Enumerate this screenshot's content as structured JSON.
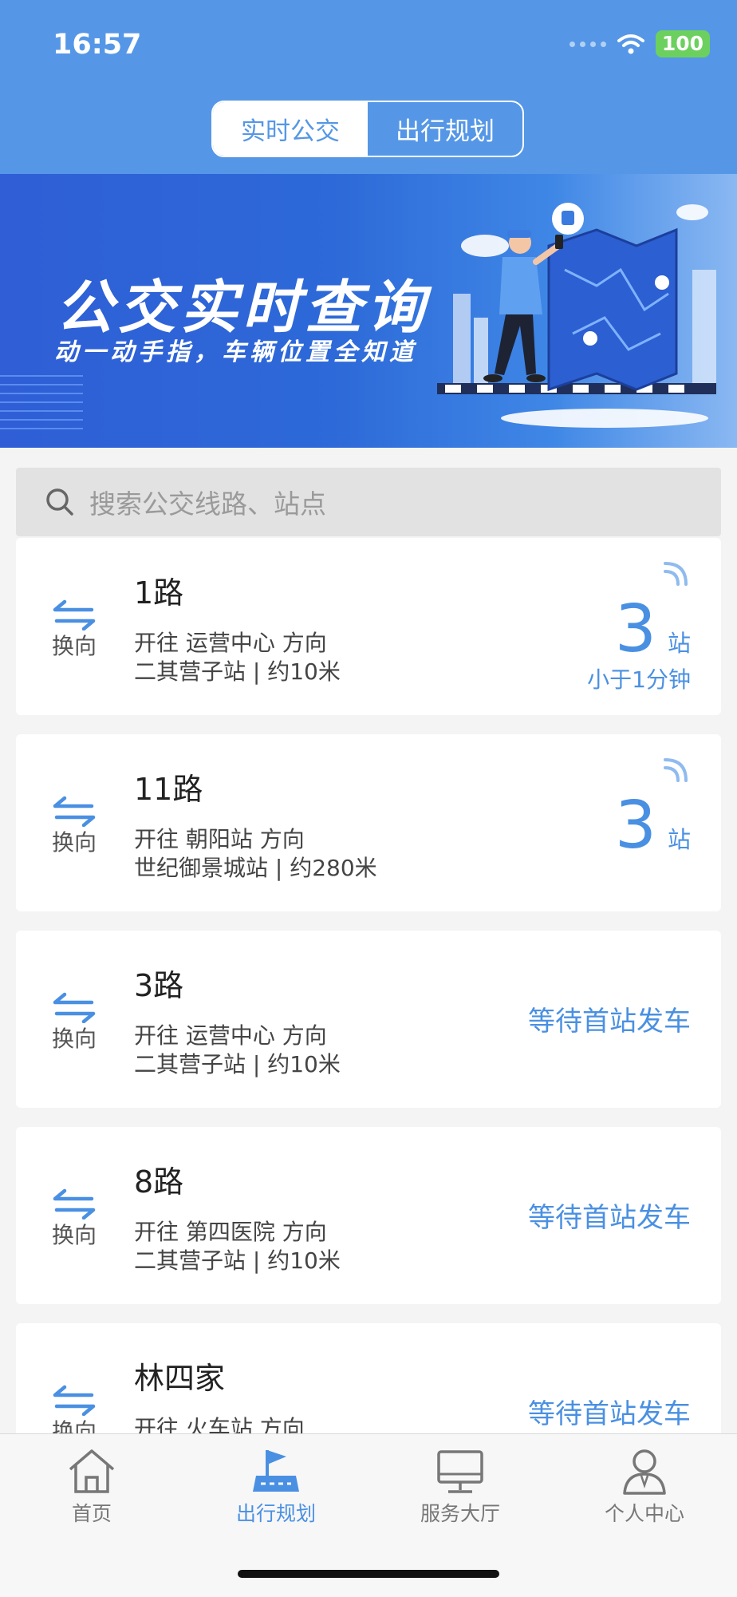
{
  "status_bar": {
    "time": "16:57",
    "battery": "100"
  },
  "segment": {
    "tabs": [
      "实时公交",
      "出行规划"
    ],
    "active_index": 0
  },
  "banner": {
    "title": "公交实时查询",
    "subtitle": "动一动手指，车辆位置全知道"
  },
  "search": {
    "placeholder": "搜索公交线路、站点"
  },
  "swap_label": "换向",
  "routes": [
    {
      "name": "1路",
      "direction": "开往 运营中心 方向",
      "stop": "二其营子站 | 约10米",
      "stops_away": "3",
      "unit": "站",
      "eta": "小于1分钟",
      "wait": ""
    },
    {
      "name": "11路",
      "direction": "开往 朝阳站 方向",
      "stop": "世纪御景城站 | 约280米",
      "stops_away": "3",
      "unit": "站",
      "eta": "",
      "wait": ""
    },
    {
      "name": "3路",
      "direction": "开往 运营中心 方向",
      "stop": "二其营子站 | 约10米",
      "stops_away": "",
      "unit": "",
      "eta": "",
      "wait": "等待首站发车"
    },
    {
      "name": "8路",
      "direction": "开往 第四医院 方向",
      "stop": "二其营子站 | 约10米",
      "stops_away": "",
      "unit": "",
      "eta": "",
      "wait": "等待首站发车"
    },
    {
      "name": "林四家",
      "direction": "开往 火车站 方向",
      "stop": "",
      "stops_away": "",
      "unit": "",
      "eta": "",
      "wait": "等待首站发车"
    }
  ],
  "tabbar": {
    "items": [
      {
        "label": "首页",
        "icon": "home-icon"
      },
      {
        "label": "出行规划",
        "icon": "flag-map-icon"
      },
      {
        "label": "服务大厅",
        "icon": "monitor-icon"
      },
      {
        "label": "个人中心",
        "icon": "user-icon"
      }
    ],
    "active_index": 1
  },
  "colors": {
    "primary": "#5597e6",
    "accent": "#4a90e2",
    "battery": "#6cd05e"
  }
}
